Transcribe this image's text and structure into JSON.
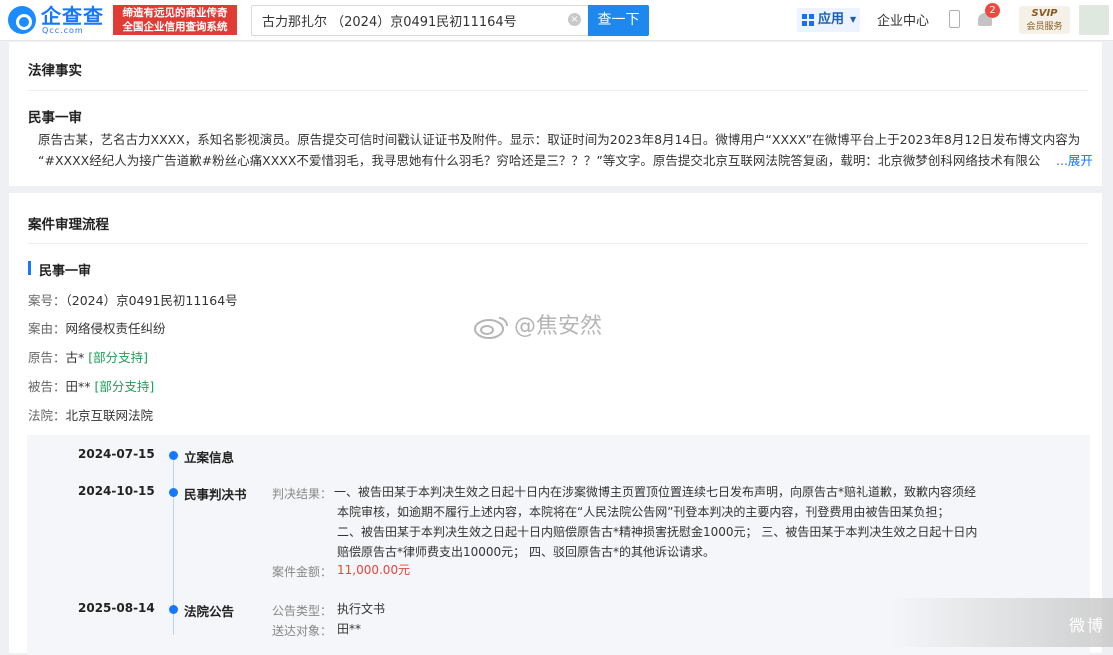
{
  "header": {
    "logo_name": "企查查",
    "logo_domain": "Qcc.com",
    "slogan_line1": "缔造有远见的商业传奇",
    "slogan_line2": "全国企业信用查询系统",
    "search_value": "古力那扎尔 （2024）京0491民初11164号",
    "search_button": "查一下",
    "app_label": "应用",
    "center_link": "企业中心",
    "notification_count": "2",
    "svip_title": "SVIP",
    "svip_sub": "会员服务"
  },
  "legal_facts": {
    "title": "法律事实",
    "stage": "民事一审",
    "text_line1": "原告古某，艺名古力XXXX，系知名影视演员。原告提交可信时间戳认证证书及附件。显示：取证时间为2023年8月14日。微博用户“XXXX”在微博平台上于2023年8月12日发布博文内容为",
    "text_line2": "“#XXXX经纪人为接广告道歉#粉丝心痛XXXX不爱惜羽毛，我寻思她有什么羽毛？穷哈还是三？？？”等文字。原告提交北京互联网法院答复函，载明：北京微梦创科网络技术有限公",
    "expand": "...展开"
  },
  "process": {
    "title": "案件审理流程",
    "stage": "民事一审",
    "case_no_key": "案号：",
    "case_no": "（2024）京0491民初11164号",
    "cause_key": "案由：",
    "cause": "网络侵权责任纠纷",
    "plaintiff_key": "原告：",
    "plaintiff": "古*",
    "plaintiff_tag": "[部分支持]",
    "defendant_key": "被告：",
    "defendant": "田**",
    "defendant_tag": "[部分支持]",
    "court_key": "法院：",
    "court": "北京互联网法院"
  },
  "timeline": [
    {
      "date": "2024-07-15",
      "event": "立案信息"
    },
    {
      "date": "2024-10-15",
      "event": "民事判决书",
      "result_key": "判决结果：",
      "result_1": "一、被告田某于本判决生效之日起十日内在涉案微博主页置顶位置连续七日发布声明，向原告古*赔礼道歉，致歉内容须经",
      "result_2": "本院审核，如逾期不履行上述内容，本院将在“人民法院公告网”刊登本判决的主要内容，刊登费用由被告田某负担；",
      "result_3": "二、被告田某于本判决生效之日起十日内赔偿原告古*精神损害抚慰金1000元；  三、被告田某于本判决生效之日起十日内",
      "result_4": "赔偿原告古*律师费支出10000元；  四、驳回原告古*的其他诉讼请求。",
      "amount_key": "案件金额：",
      "amount": "11,000.00元"
    },
    {
      "date": "2025-08-14",
      "event": "法院公告",
      "type_key": "公告类型：",
      "type": "执行文书",
      "target_key": "送达对象：",
      "target": "田**"
    }
  ],
  "watermark": "@焦安然",
  "corner_watermark": "微博"
}
